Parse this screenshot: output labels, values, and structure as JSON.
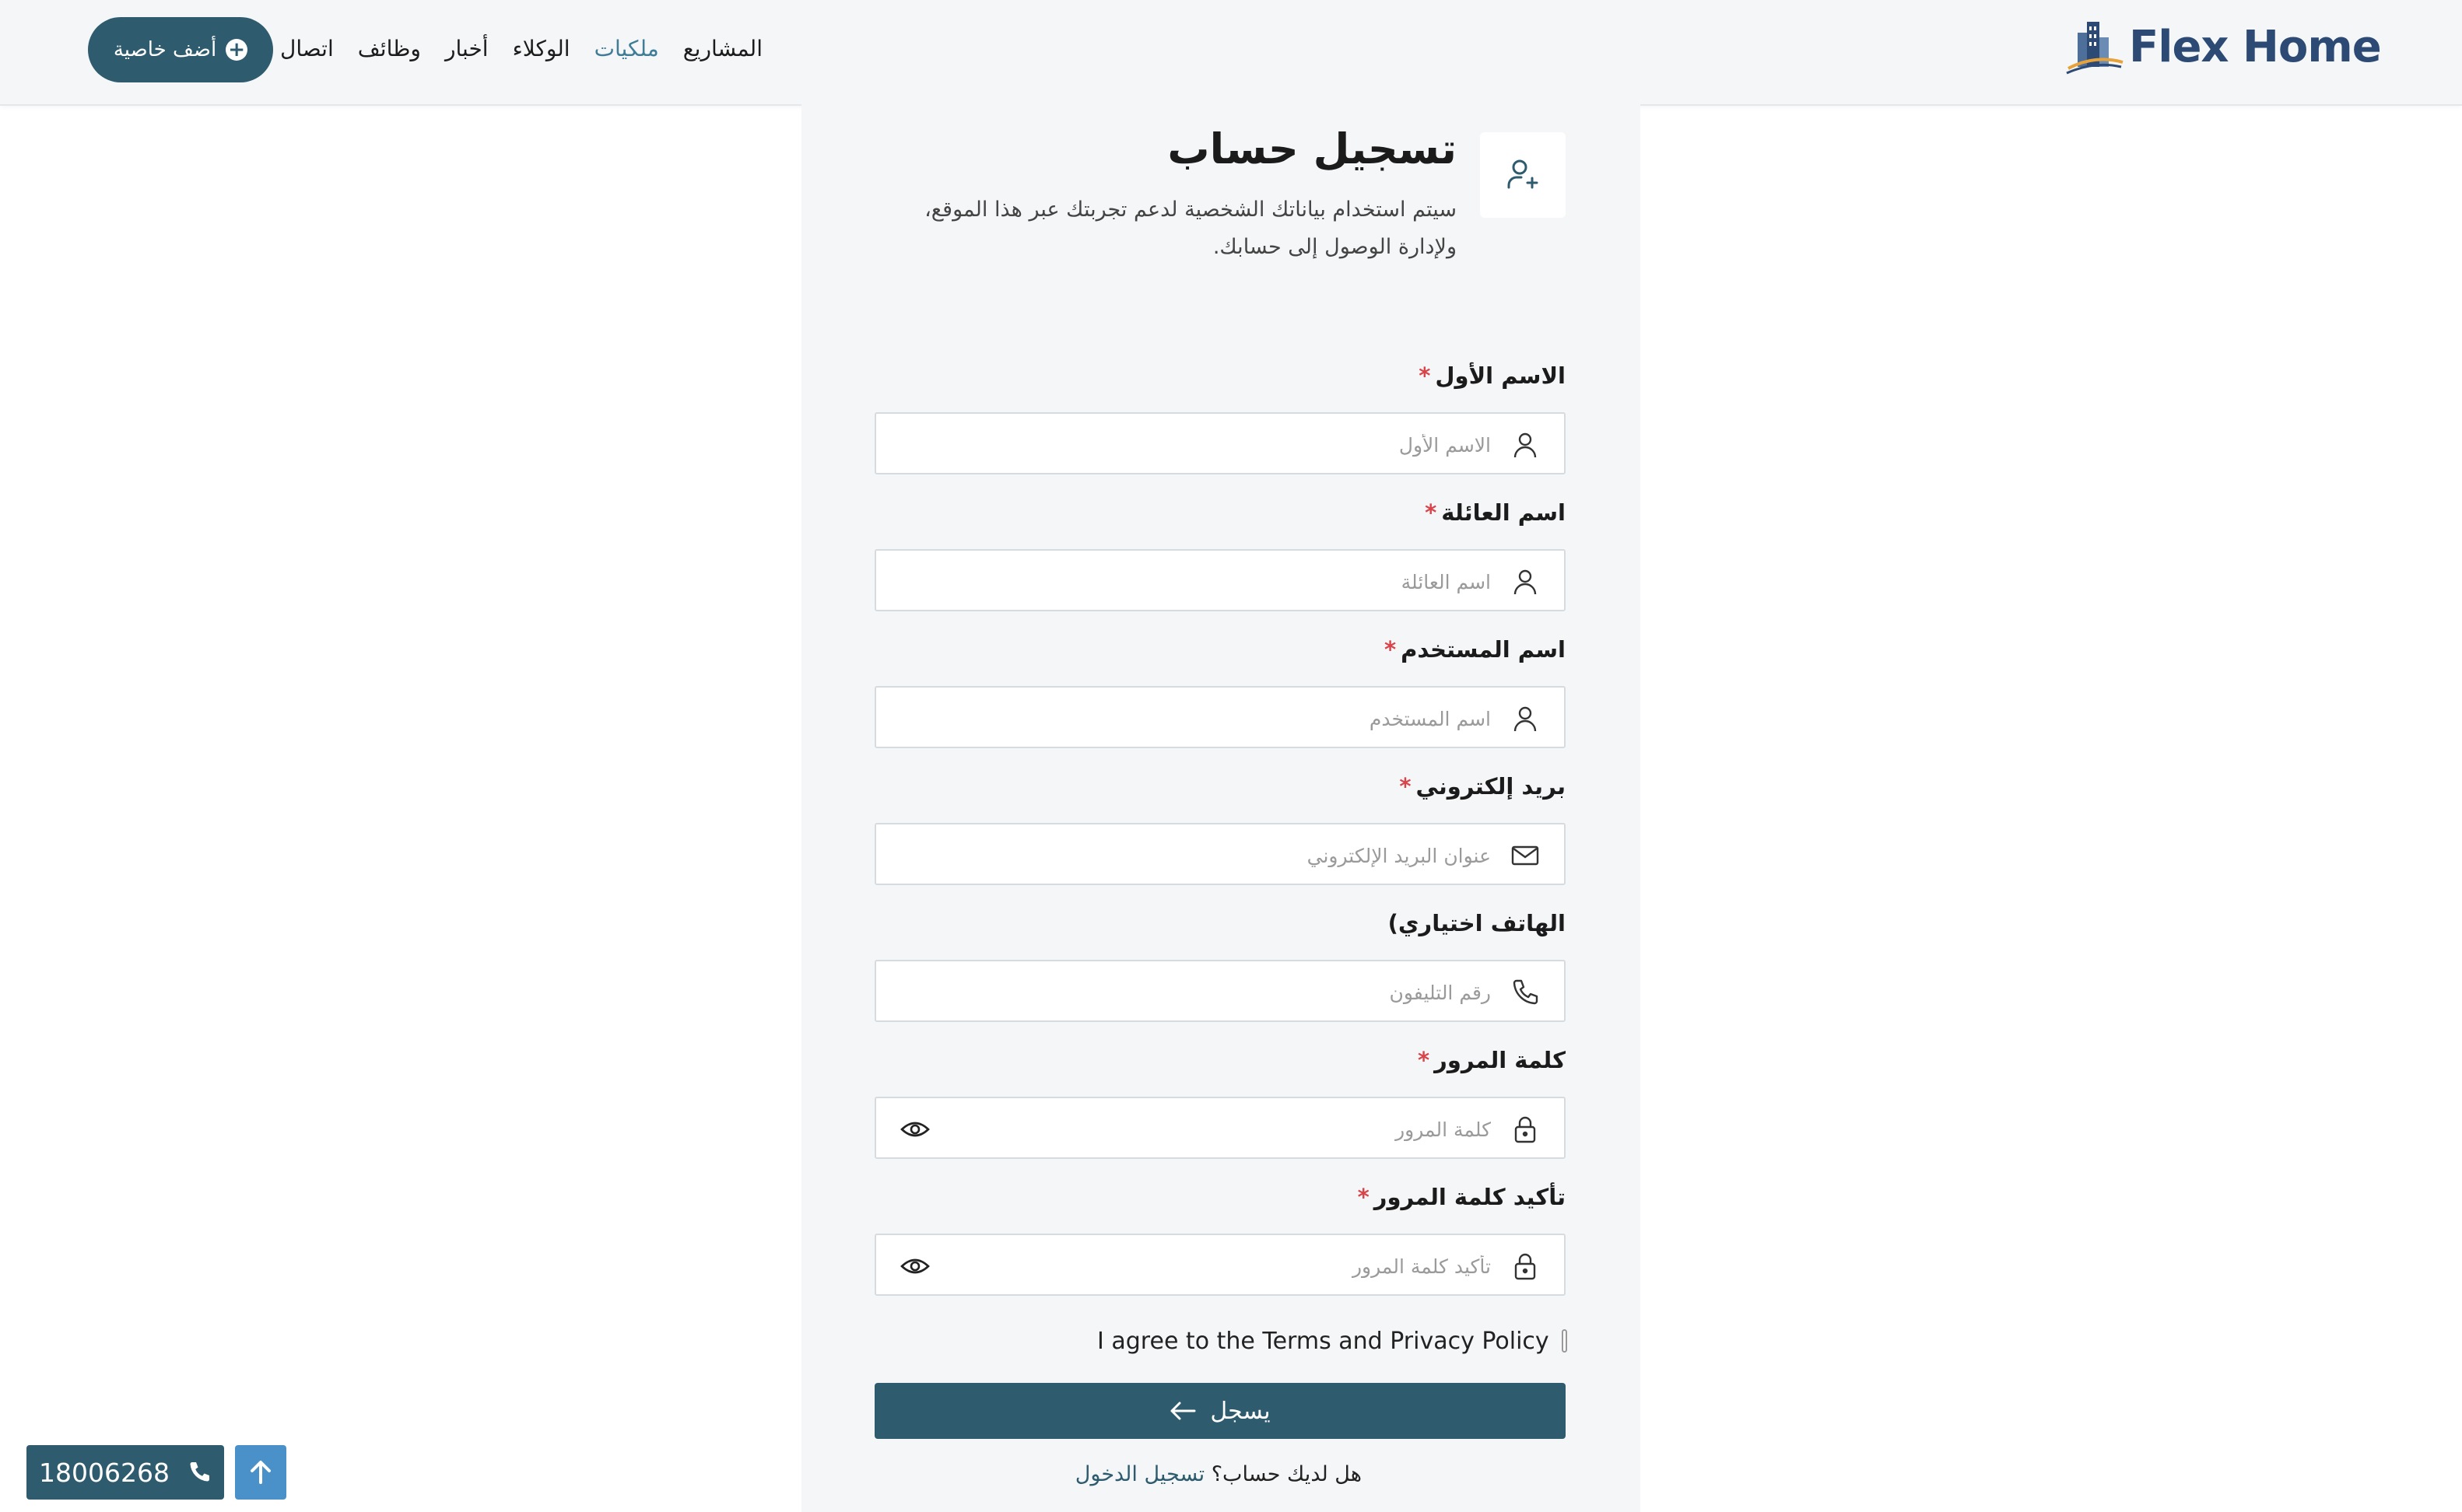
{
  "header": {
    "logo_text": "Flex Home",
    "nav": [
      {
        "label": "المشاريع",
        "active": false
      },
      {
        "label": "ملكيات",
        "active": true
      },
      {
        "label": "الوكلاء",
        "active": false
      },
      {
        "label": "أخبار",
        "active": false
      },
      {
        "label": "وظائف",
        "active": false
      },
      {
        "label": "اتصال",
        "active": false
      }
    ],
    "add_property_label": "أضف خاصية"
  },
  "form": {
    "title": "تسجيل حساب",
    "subtitle": "سيتم استخدام بياناتك الشخصية لدعم تجربتك عبر هذا الموقع، ولإدارة الوصول إلى حسابك.",
    "fields": [
      {
        "label": "الاسم الأول",
        "required": "*",
        "placeholder": "الاسم الأول",
        "icon": "user-icon"
      },
      {
        "label": "اسم العائلة",
        "required": "*",
        "placeholder": "اسم العائلة",
        "icon": "user-icon"
      },
      {
        "label": "اسم المستخدم",
        "required": "*",
        "placeholder": "اسم المستخدم",
        "icon": "user-icon"
      },
      {
        "label": "بريد إلكتروني",
        "required": "*",
        "placeholder": "عنوان البريد الإلكتروني",
        "icon": "mail-icon"
      },
      {
        "label": "الهاتف اختياري)",
        "required": "",
        "placeholder": "رقم التليفون",
        "icon": "phone-icon"
      },
      {
        "label": "كلمة المرور",
        "required": "*",
        "placeholder": "كلمة المرور",
        "icon": "lock-icon"
      },
      {
        "label": "تأكيد كلمة المرور",
        "required": "*",
        "placeholder": "تأكيد كلمة المرور",
        "icon": "lock-icon"
      }
    ],
    "terms_label": "I agree to the Terms and Privacy Policy",
    "submit_label": "يسجل",
    "have_account": "هل لديك حساب؟",
    "login_link": "تسجيل الدخول"
  },
  "floating": {
    "phone_number": "18006268"
  },
  "colors": {
    "primary": "#2e5b6d",
    "accent_link": "#3f7c96",
    "required": "#d9434a",
    "scroll_top": "#4a90c9"
  }
}
